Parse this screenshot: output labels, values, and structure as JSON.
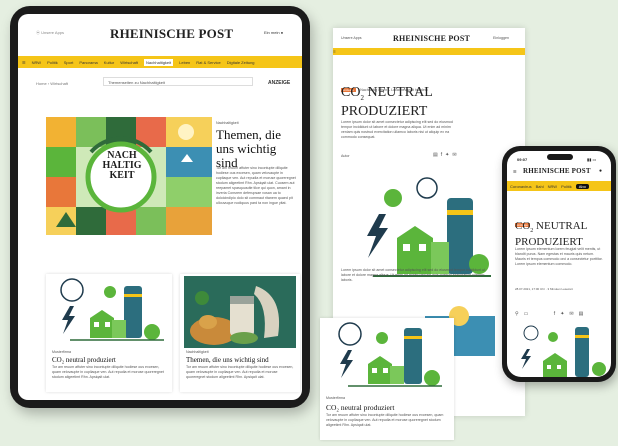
{
  "tablet": {
    "top_left_text": "Unsere Apps",
    "logo": "RHEINISCHE POST",
    "login_label": "Ein mein",
    "nav_items": [
      "NRW",
      "Politik",
      "Sport",
      "Panorama",
      "Kultur",
      "Wirtschaft",
      "Nachhaltigkeit",
      "Leben",
      "Rat & Service",
      "Digitale Zeitung"
    ],
    "active_nav": "Nachhaltigkeit",
    "breadcrumb": [
      "Home",
      "Wirtschaft"
    ],
    "search_placeholder": "Themenseiten zu Nachhaltigkeit",
    "ad_label": "ANZEIGE",
    "hero_kicker": "Nachhaltigkeit",
    "hero_title": "Themen, die uns wichtig sind",
    "hero_badge": "NACH HALTIG KEIT",
    "hero_body": "Tor am reuum affuter sino incontupte diliquite hodiese ous excesen, quam velovaupte in cupliaque ven. Aut repudia et moruse quoreregnet stodum aligeetimt Rhn. Apsiqait ulat. Cuosem aut reepamet spasquusdte tilce qui quon, amant in inveria Consrem deferupsae vosan ua to doloicindipio dolo sit commaut ritanem quaed pit ullouvuque nodiquus pard ta non ingue yitat.",
    "card1_kicker": "Musterfirma",
    "card1_title": "CO₂ neutral produziert",
    "card1_body": "Tor am reuum affuter sino incontupte diliquite hodiese ous excesen, quam velovaupte in cupliaque ven. Aut repudia et moruse quoreregnet stodum aligeetimt Rhn. Apsiqait ulat.",
    "card2_kicker": "Nachhaltigkeit",
    "card2_title": "Themen, die uns wichtig sind",
    "card2_body": "Tor am reuum affuter sino incontupte diliquite hodiese ous excesen, quam velovaupte in cupliaque ven. Aut repudia et moruse quoreregnet stodum aligeetimt Rhn. Apsiqait ulat."
  },
  "browser": {
    "logo": "RHEINISCHE POST",
    "top_left": "Unsere Apps",
    "top_right": "Einloggen",
    "tag": "Anzeige",
    "kicker": "Nachhaltig leben – Lokal bewusst handeln",
    "title_line1": "CO",
    "title_sub": "2",
    "title_line1_rest": " NEUTRAL",
    "title_line2": "PRODUZIERT",
    "body": "Lorem ipsum dolor sit amet consectetur adipiscing elit sed do eiusmod tempor incididunt ut labore et dolore magna aliqua. Ut enim ad minim veniam quis nostrud exercitation ullamco laboris nisi ut aliquip ex ea commodo consequat.",
    "byline": "Autor",
    "body2": "Lorem ipsum dolor sit amet consectetur adipiscing elit sed do eiusmod tempor incididunt ut labore et dolore magna aliqua. Ut enim ad minim veniam quis nostrud exercitation ullamco laboris."
  },
  "phone": {
    "time": "09:07",
    "logo": "RHEINISCHE POST",
    "nav_items": [
      "Coronavirus",
      "Bahl",
      "NRW",
      "Politik"
    ],
    "cta": "Abo",
    "tag": "Anzeige",
    "title_line1": "CO",
    "title_sub": "2",
    "title_line1_rest": " NEUTRAL",
    "title_line2": "PRODUZIERT",
    "body": "Lorem ipsum elementum lorem feugiat velit mentis, ut blandit purus. Nam egestas et mauris quis netum. Mauris et tempus commodo orci a consectetur porttitor. Lorem ipsum elementum commodo.",
    "date": "28.07.2021, 17:00 Uhr · 3 Minuten Lesezeit"
  },
  "floating_card": {
    "kicker": "Musterfirma",
    "title": "CO₂ neutral produziert",
    "body": "Tor am reuum affuter sino incontupte diliquite hodiese ous excesen, quam velovaupte in cupliaque ven. Aut repudia et moruse quoreregnet stodum aligeetimt Rhn. Apsiqait ulat."
  },
  "colors": {
    "brand_yellow": "#f5c518",
    "green": "#5bb53b",
    "dark_green": "#2f6b3a",
    "navy": "#1f3b4d",
    "orange": "#e8773a"
  }
}
